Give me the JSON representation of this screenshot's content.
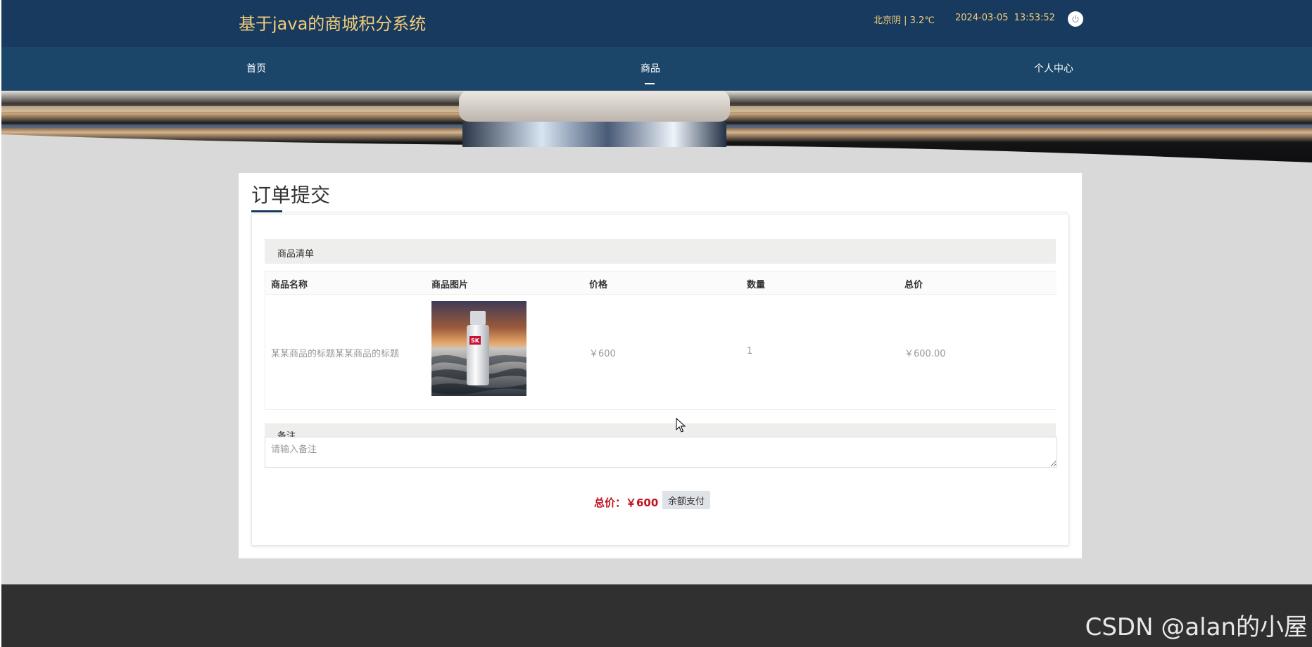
{
  "header": {
    "site_title": "基于java的商城积分系统",
    "weather": "北京阴 | 3.2℃",
    "date": "2024-03-05",
    "time": "13:53:52",
    "power_icon": "power-icon"
  },
  "nav": {
    "items": [
      {
        "label": "首页",
        "active": false
      },
      {
        "label": "商品",
        "active": true
      },
      {
        "label": "个人中心",
        "active": false
      }
    ]
  },
  "page": {
    "title": "订单提交"
  },
  "order": {
    "goods_section_title": "商品清单",
    "columns": [
      "商品名称",
      "商品图片",
      "价格",
      "数量",
      "总价"
    ],
    "rows": [
      {
        "name": "某某商品的标题某某商品的标题",
        "image": "product-image",
        "price": "￥600",
        "quantity": "1",
        "total": "￥600.00"
      }
    ],
    "remark_section_title": "备注",
    "remark_placeholder": "请输入备注",
    "total_label": "总价：￥600",
    "pay_button": "余额支付"
  },
  "footer": {
    "watermark": "CSDN @alan的小屋"
  },
  "colors": {
    "topbar": "#173a5e",
    "navbar": "#1b4669",
    "title_gold": "#f3cb7a",
    "total_red": "#c0141f",
    "footer": "#303030"
  }
}
